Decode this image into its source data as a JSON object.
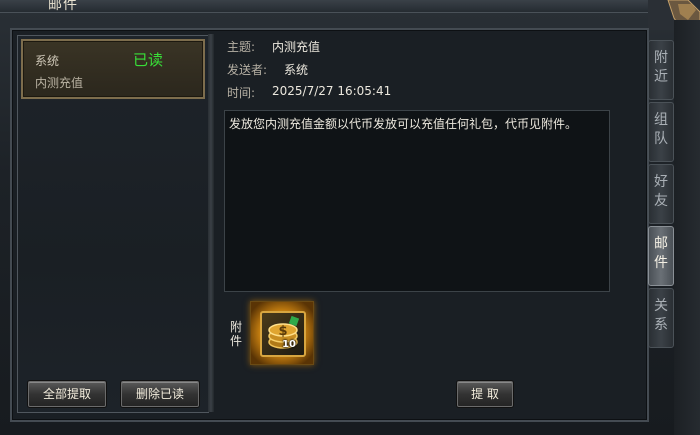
{
  "window": {
    "title": "邮件"
  },
  "mail_list": {
    "items": [
      {
        "sender": "系统",
        "status": "已读",
        "subject": "内测充值"
      }
    ]
  },
  "detail": {
    "subject_label": "主题:",
    "subject_value": "内测充值",
    "sender_label": "发送者:",
    "sender_value": "系统",
    "time_label": "时间:",
    "time_value": "2025/7/27 16:05:41",
    "body": "发放您内测充值金额以代币发放可以充值任何礼包，代币见附件。",
    "attachment_label": "附件",
    "attachment": {
      "icon": "coin-stack-icon",
      "count": "10"
    }
  },
  "buttons": {
    "collect_all": "全部提取",
    "delete_read": "删除已读",
    "collect": "提 取"
  },
  "side_tabs": [
    {
      "label": "附近",
      "active": false
    },
    {
      "label": "组队",
      "active": false
    },
    {
      "label": "好友",
      "active": false
    },
    {
      "label": "邮件",
      "active": true
    },
    {
      "label": "关系",
      "active": false
    }
  ],
  "colors": {
    "read_status": "#38e038",
    "selected_border": "#7d6d4d"
  }
}
